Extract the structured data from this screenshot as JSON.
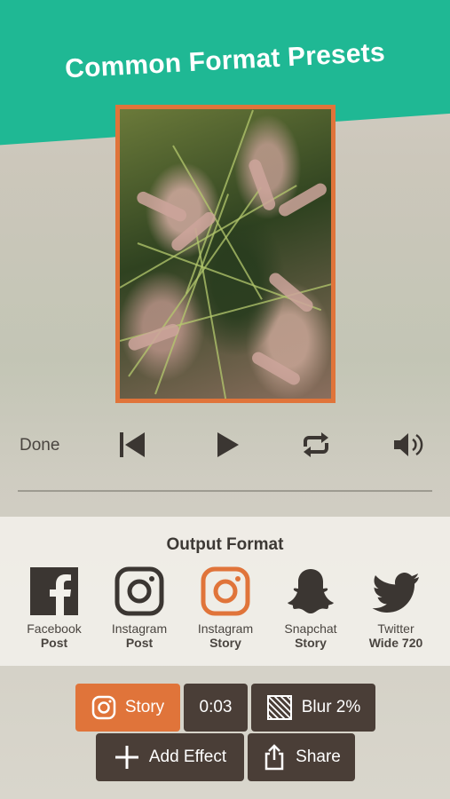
{
  "banner": {
    "title": "Common Format Presets"
  },
  "player": {
    "done_label": "Done"
  },
  "output_format": {
    "title": "Output Format",
    "options": [
      {
        "line1": "Facebook",
        "line2": "Post",
        "icon": "facebook-icon"
      },
      {
        "line1": "Instagram",
        "line2": "Post",
        "icon": "instagram-icon"
      },
      {
        "line1": "Instagram",
        "line2": "Story",
        "icon": "instagram-icon",
        "selected": true
      },
      {
        "line1": "Snapchat",
        "line2": "Story",
        "icon": "snapchat-icon"
      },
      {
        "line1": "Twitter",
        "line2": "Wide 720",
        "icon": "twitter-icon"
      }
    ]
  },
  "toolbar": {
    "format_label": "Story",
    "duration_label": "0:03",
    "blur_label": "Blur 2%",
    "add_effect_label": "Add Effect",
    "share_label": "Share"
  },
  "colors": {
    "accent_green": "#1fb894",
    "accent_orange": "#e0743a",
    "button_dark": "#4a3e37"
  }
}
